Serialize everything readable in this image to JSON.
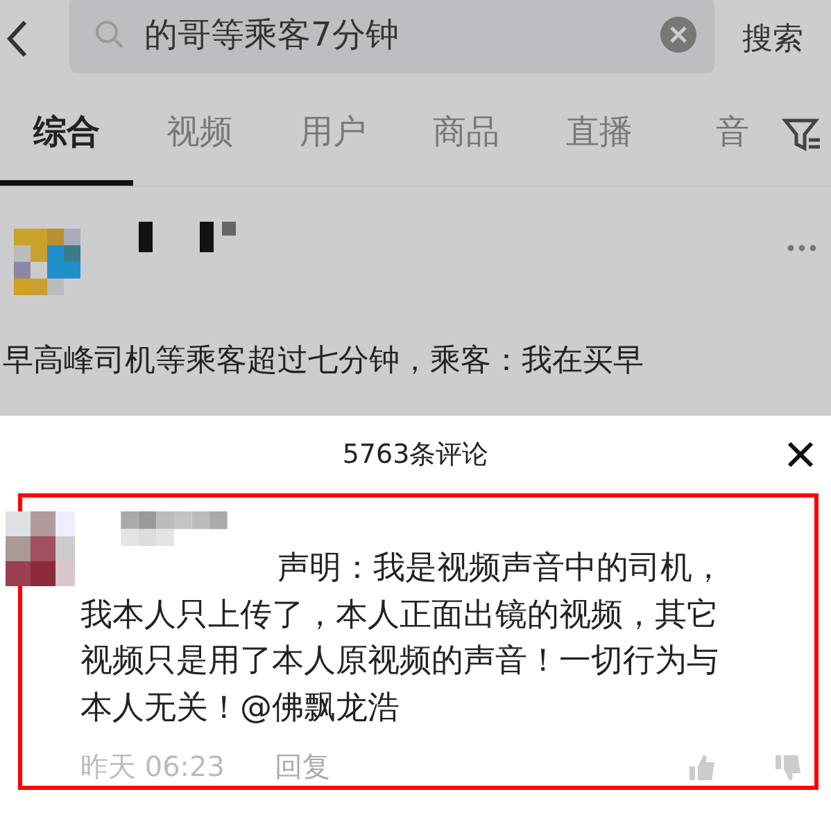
{
  "search": {
    "value": "的哥等乘客7分钟",
    "button": "搜索"
  },
  "tabs": [
    {
      "label": "综合",
      "selected": true
    },
    {
      "label": "视频",
      "selected": false
    },
    {
      "label": "用户",
      "selected": false
    },
    {
      "label": "商品",
      "selected": false
    },
    {
      "label": "直播",
      "selected": false
    },
    {
      "label": "音",
      "selected": false
    }
  ],
  "post": {
    "caption": "早高峰司机等乘客超过七分钟，乘客：我在买早"
  },
  "comments_sheet": {
    "title": "5763条评论",
    "comment": {
      "text": "声明：我是视频声音中的司机，我本人只上传了，本人正面出镜的视频，其它视频只是用了本人原视频的声音！一切行为与本人无关！@佛飘龙浩",
      "time": "昨天 06:23",
      "reply": "回复",
      "highlighted": true
    }
  }
}
